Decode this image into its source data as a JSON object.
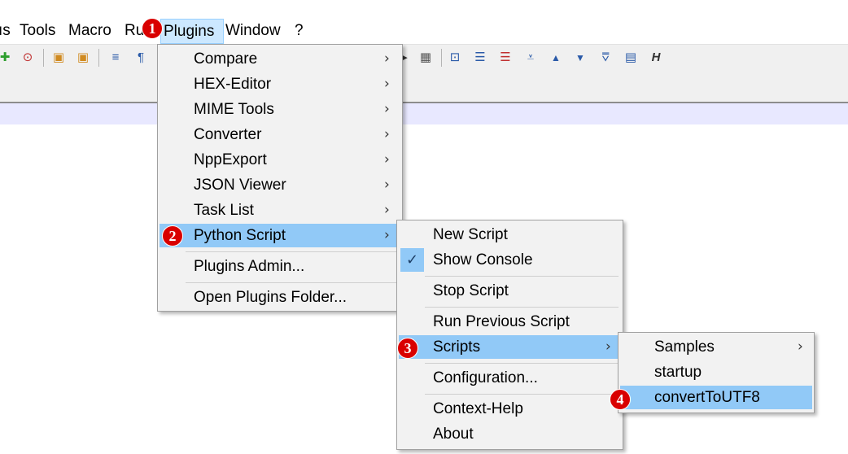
{
  "menubar": {
    "items": [
      "ıs",
      "Tools",
      "Macro",
      "Ru",
      "Plugins",
      "Window",
      "?"
    ]
  },
  "plugins_menu": {
    "items": [
      {
        "label": "Compare",
        "arrow": "›"
      },
      {
        "label": "HEX-Editor",
        "arrow": "›"
      },
      {
        "label": "MIME Tools",
        "arrow": "›"
      },
      {
        "label": "Converter",
        "arrow": "›"
      },
      {
        "label": "NppExport",
        "arrow": "›"
      },
      {
        "label": "JSON Viewer",
        "arrow": "›"
      },
      {
        "label": "Task List",
        "arrow": "›"
      },
      {
        "label": "Python Script",
        "arrow": "›"
      },
      {
        "label": "Plugins Admin..."
      },
      {
        "label": "Open Plugins Folder..."
      }
    ]
  },
  "python_menu": {
    "items": [
      {
        "label": "New Script"
      },
      {
        "label": "Show Console",
        "checked": true
      },
      {
        "label": "Stop Script"
      },
      {
        "label": "Run Previous Script"
      },
      {
        "label": "Scripts",
        "arrow": "›"
      },
      {
        "label": "Configuration..."
      },
      {
        "label": "Context-Help"
      },
      {
        "label": "About"
      }
    ]
  },
  "scripts_menu": {
    "items": [
      {
        "label": "Samples",
        "arrow": "›"
      },
      {
        "label": "startup"
      },
      {
        "label": "convertToUTF8"
      }
    ]
  },
  "badges": [
    "1",
    "2",
    "3",
    "4"
  ],
  "checkmark": "✓",
  "toolbar_icons": [
    "plus-icon",
    "zoom-icon",
    "lock-doc-icon",
    "lock-doc2-icon",
    "wrap-icon",
    "pilcrow-icon",
    "pilcrow-symbol",
    "play-icon",
    "macro-icon",
    "bookmark-icon",
    "list-icon",
    "list-red-icon",
    "nav-top-icon",
    "nav-up-icon",
    "nav-down-icon",
    "nav-bottom-icon",
    "panel-icon",
    "h-icon",
    "h-letter"
  ],
  "toolbar_glyphs": {
    "pilcrow": "¶",
    "h": "H"
  },
  "colors": {
    "highlight": "#91c9f7",
    "badge": "#d90000",
    "menu_bg": "#f2f2f2",
    "active_menubar": "#cce8ff"
  }
}
